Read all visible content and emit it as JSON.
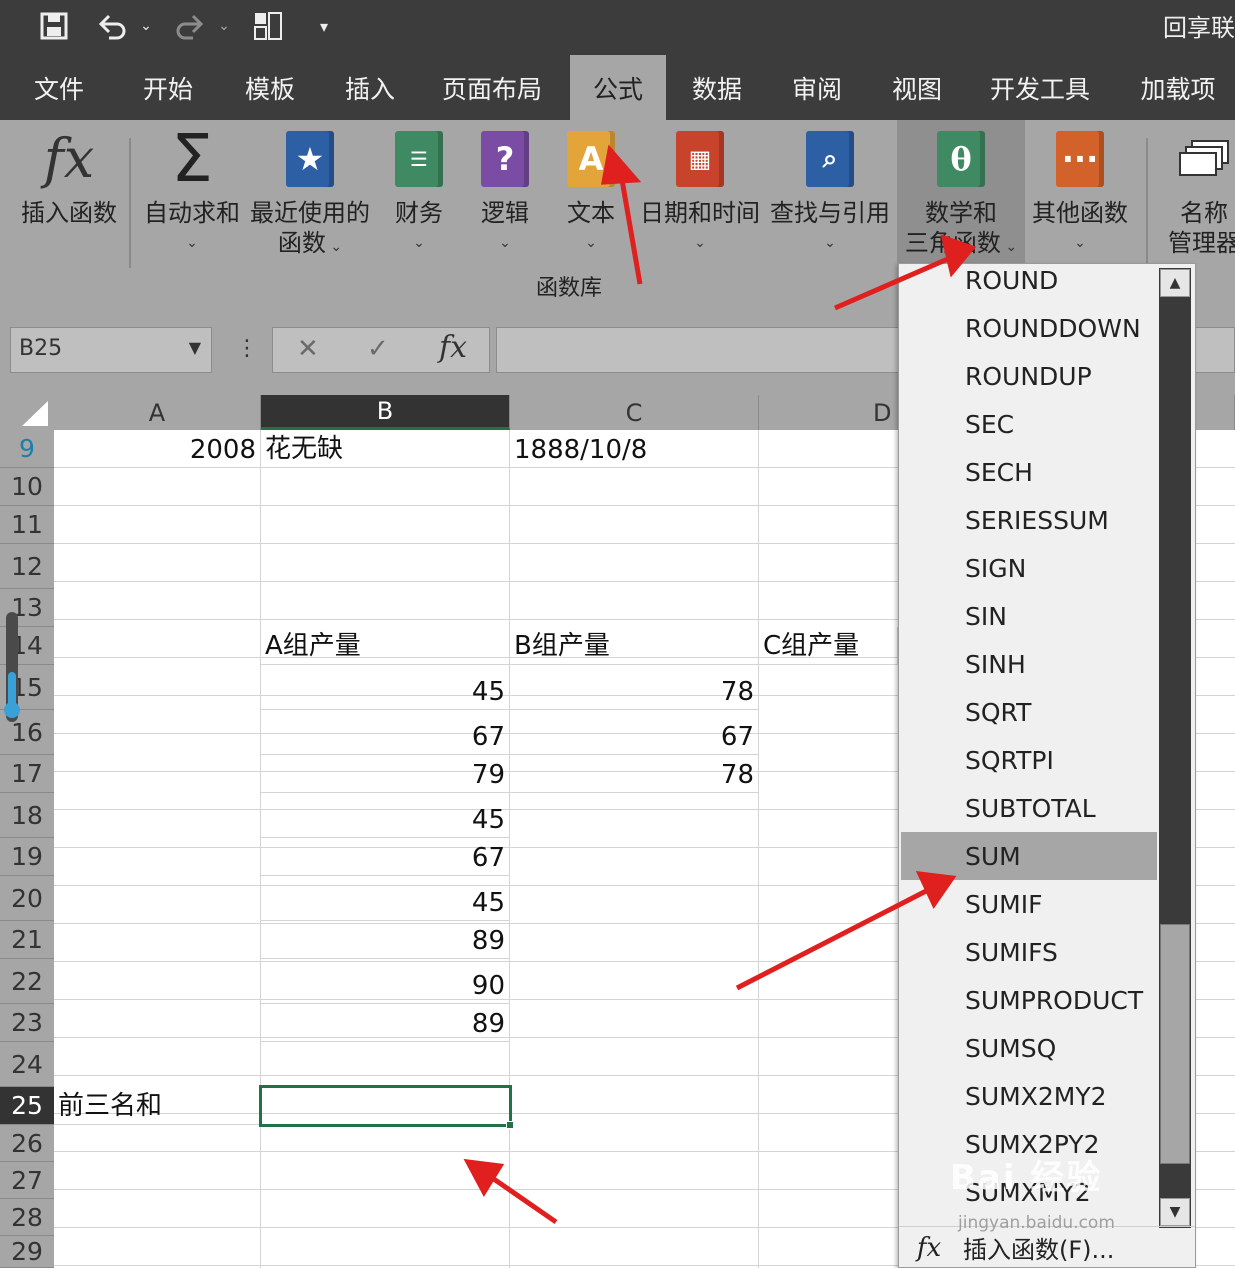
{
  "title": "回享联",
  "tabs": [
    "文件",
    "开始",
    "模板",
    "插入",
    "页面布局",
    "公式",
    "数据",
    "审阅",
    "视图",
    "开发工具",
    "加载项"
  ],
  "active_tab": "公式",
  "ribbon": {
    "insert_function": "插入函数",
    "autosum": "自动求和",
    "recent_line1": "最近使用的",
    "recent_line2": "函数",
    "finance": "财务",
    "logic": "逻辑",
    "text": "文本",
    "datetime": "日期和时间",
    "lookup": "查找与引用",
    "math_line1": "数学和",
    "math_line2": "三角函数",
    "other": "其他函数",
    "name_line1": "名称",
    "name_line2": "管理器",
    "group_label": "函数库"
  },
  "namebox": "B25",
  "columns": [
    "A",
    "B",
    "C",
    "D"
  ],
  "rows": [
    "9",
    "10",
    "11",
    "12",
    "13",
    "14",
    "15",
    "16",
    "17",
    "18",
    "19",
    "20",
    "21",
    "22",
    "23",
    "24",
    "25",
    "26",
    "27",
    "28",
    "29"
  ],
  "cells": {
    "A9": "2008",
    "B9": "花无缺",
    "C9": "1888/10/8",
    "B14": "A组产量",
    "C14": "B组产量",
    "D14": "C组产量",
    "B15": "45",
    "C15": "78",
    "B16": "67",
    "C16": "67",
    "B17": "79",
    "C17": "78",
    "B18": "45",
    "B19": "67",
    "B20": "45",
    "B21": "89",
    "B22": "90",
    "B23": "89",
    "A25": "前三名和"
  },
  "functions": [
    "ROUND",
    "ROUNDDOWN",
    "ROUNDUP",
    "SEC",
    "SECH",
    "SERIESSUM",
    "SIGN",
    "SIN",
    "SINH",
    "SQRT",
    "SQRTPI",
    "SUBTOTAL",
    "SUM",
    "SUMIF",
    "SUMIFS",
    "SUMPRODUCT",
    "SUMSQ",
    "SUMX2MY2",
    "SUMX2PY2",
    "SUMXMY2"
  ],
  "highlighted_function": "SUM",
  "insert_function_item": "插入函数(F)...",
  "watermark": "Bai 经验",
  "watermark_url": "jingyan.baidu.com",
  "colors": {
    "ribbon": "#a6a6a6",
    "dark": "#3c3c3c",
    "selection": "#217346",
    "arrow": "#e0201e"
  }
}
